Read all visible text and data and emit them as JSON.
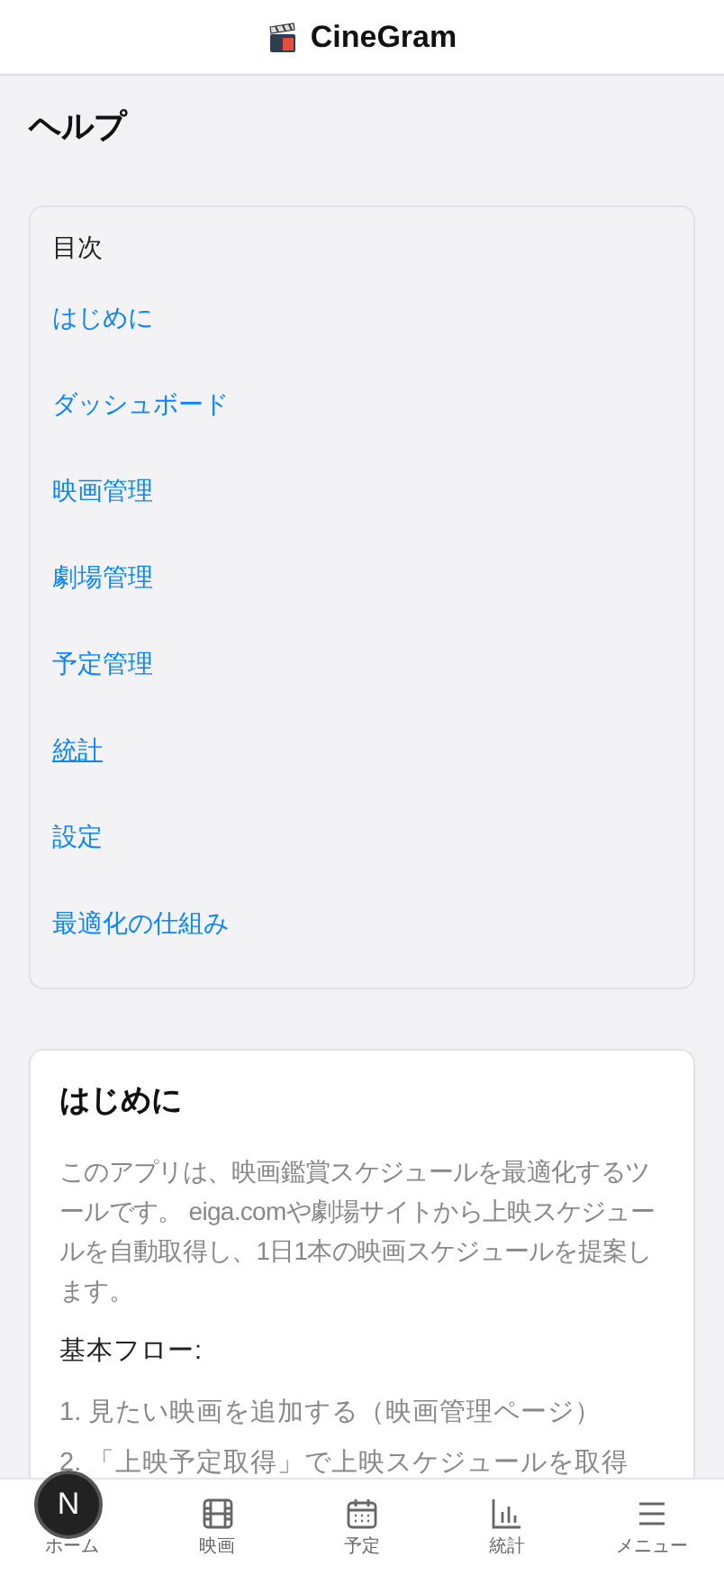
{
  "header": {
    "title": "CineGram"
  },
  "page_title": "ヘルプ",
  "toc": {
    "heading": "目次",
    "items": [
      {
        "label": "はじめに",
        "selected": false
      },
      {
        "label": "ダッシュボード",
        "selected": false
      },
      {
        "label": "映画管理",
        "selected": false
      },
      {
        "label": "劇場管理",
        "selected": false
      },
      {
        "label": "予定管理",
        "selected": false
      },
      {
        "label": "統計",
        "selected": true
      },
      {
        "label": "設定",
        "selected": false
      },
      {
        "label": "最適化の仕組み",
        "selected": false
      }
    ]
  },
  "intro": {
    "heading": "はじめに",
    "body": "このアプリは、映画鑑賞スケジュールを最適化するツールです。 eiga.comや劇場サイトから上映スケジュールを自動取得し、1日1本の映画スケジュールを提案します。",
    "flow_heading": "基本フロー:",
    "steps": [
      "1. 見たい映画を追加する（映画管理ページ）",
      "2. 「上映予定取得」で上映スケジュールを取得"
    ]
  },
  "dev_badge": "N",
  "bottom_nav": [
    {
      "kind": "home",
      "label": "ホーム"
    },
    {
      "kind": "film",
      "label": "映画"
    },
    {
      "kind": "calendar",
      "label": "予定"
    },
    {
      "kind": "stats",
      "label": "統計"
    },
    {
      "kind": "menu",
      "label": "メニュー"
    }
  ]
}
